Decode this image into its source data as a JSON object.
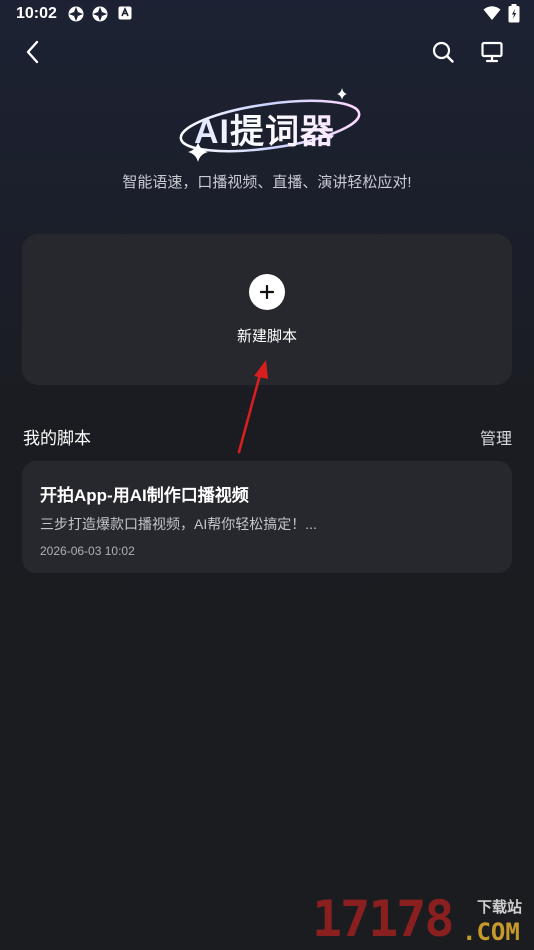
{
  "status": {
    "time": "10:02"
  },
  "header": {
    "logo_text": "AI提词器",
    "subtitle": "智能语速，口播视频、直播、演讲轻松应对!"
  },
  "create": {
    "label": "新建脚本"
  },
  "scripts_section": {
    "title": "我的脚本",
    "manage_label": "管理"
  },
  "scripts": [
    {
      "title": "开拍App-用AI制作口播视频",
      "desc": "三步打造爆款口播视频，AI帮你轻松搞定！...",
      "date": "2026-06-03 10:02"
    }
  ],
  "watermark": {
    "number": "17178",
    "cn": "下载站",
    "com": ".COM"
  },
  "colors": {
    "background": "#1b1c20",
    "card": "#27282d",
    "arrow": "#d81e1e"
  },
  "icons": [
    "back-icon",
    "search-icon",
    "monitor-icon",
    "plus-icon",
    "wifi-icon",
    "battery-icon"
  ]
}
